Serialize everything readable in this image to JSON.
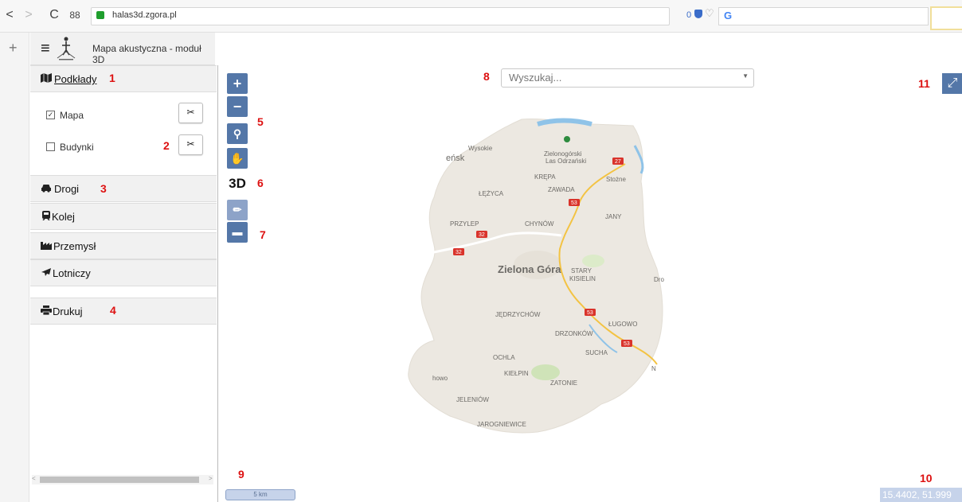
{
  "browser": {
    "url": "halas3d.zgora.pl",
    "ad_count": "0",
    "search_engine_glyph": "G",
    "nav_back": "<",
    "nav_forward": ">",
    "reload": "C",
    "apps": "88",
    "new_tab": "+"
  },
  "app": {
    "title": "Mapa akustyczna - moduł 3D",
    "menu_icon": "≡"
  },
  "sidebar": {
    "podklady": {
      "label": "Podkłady",
      "marker": "1"
    },
    "layers": [
      {
        "label": "Mapa",
        "checked": true,
        "marker": ""
      },
      {
        "label": "Budynki",
        "checked": false,
        "marker": "2"
      }
    ],
    "sections": [
      {
        "label": "Drogi",
        "icon": "car-icon",
        "marker": "3"
      },
      {
        "label": "Kolej",
        "icon": "train-icon",
        "marker": ""
      },
      {
        "label": "Przemysł",
        "icon": "factory-icon",
        "marker": ""
      },
      {
        "label": "Lotniczy",
        "icon": "plane-icon",
        "marker": ""
      }
    ],
    "print": {
      "label": "Drukuj",
      "marker": "4"
    }
  },
  "map": {
    "search_placeholder": "Wyszukaj...",
    "markers": {
      "m5": "5",
      "m6": "6",
      "m7": "7",
      "m8": "8",
      "m9": "9",
      "m10": "10",
      "m11": "11"
    },
    "tools": {
      "zoom_in": "+",
      "zoom_out": "−",
      "mode_3d": "3D"
    },
    "scale_label": "5 km",
    "coords": "15.4402, 51.999",
    "places": {
      "city": "Zielona Góra",
      "forest": "Zielonogórski Las Odrzański",
      "wysokie": "Wysokie",
      "ensk": "eńsk",
      "krepa": "KRĘPA",
      "stozne": "Stożne",
      "zawada": "ZAWADA",
      "lezyca": "ŁĘŻYCA",
      "jany": "JANY",
      "przylep": "PRZYLEP",
      "chynow": "CHYNÓW",
      "stary_kisielin": "STARY KISIELIN",
      "dros": "Dro",
      "jedrzychow": "JĘDRZYCHÓW",
      "lugowo": "ŁUGOWO",
      "drzonkow": "DRZONKÓW",
      "sucha": "SUCHA",
      "ochla": "OCHLA",
      "nowo": "howo",
      "kielpin": "KIEŁPIN",
      "zatonie": "ZATONIE",
      "jeleniow": "JELENIÓW",
      "jarogniewice": "JAROGNIEWICE",
      "n": "N",
      "road_53": "53",
      "road_32": "32",
      "road_27": "27"
    }
  },
  "colors": {
    "accent": "#5477a8",
    "marker_red": "#d11111",
    "map_land": "#ece8e1",
    "road": "#f3c343"
  }
}
